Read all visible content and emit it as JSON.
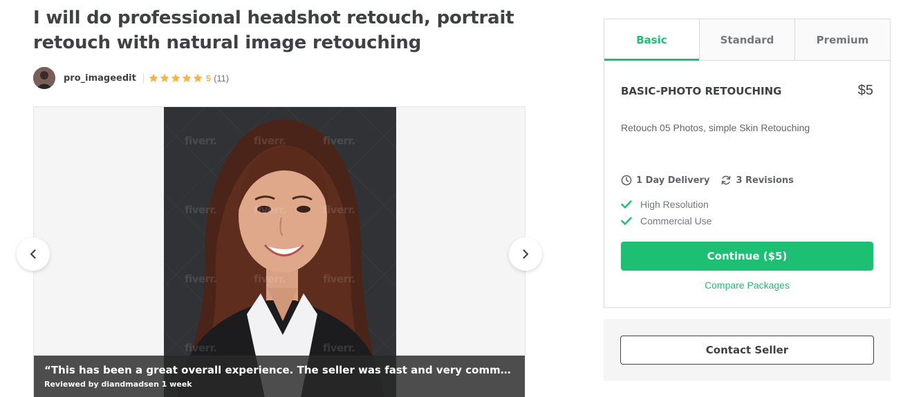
{
  "gig": {
    "title": "I will do professional headshot retouch, portrait retouch with natural image retouching"
  },
  "seller": {
    "username": "pro_imageedit",
    "rating": "5",
    "review_count": "(11)",
    "stars": 5
  },
  "gallery": {
    "watermark": "fiverr.",
    "review_quote": "“This has been a great overall experience. The seller was fast and very communicativ...",
    "reviewed_by": "Reviewed by diandmadsen 1 week"
  },
  "packages": {
    "tabs": [
      "Basic",
      "Standard",
      "Premium"
    ],
    "active_tab": "Basic",
    "name": "BASIC-PHOTO RETOUCHING",
    "price": "$5",
    "description": "Retouch 05 Photos, simple Skin Retouching",
    "delivery": "1 Day Delivery",
    "revisions": "3 Revisions",
    "features": [
      "High Resolution",
      "Commercial Use"
    ],
    "continue_label": "Continue ($5)",
    "compare_label": "Compare Packages"
  },
  "contact": {
    "label": "Contact Seller"
  },
  "colors": {
    "accent": "#1dbf73",
    "star": "#ffb33e",
    "text": "#404145"
  }
}
